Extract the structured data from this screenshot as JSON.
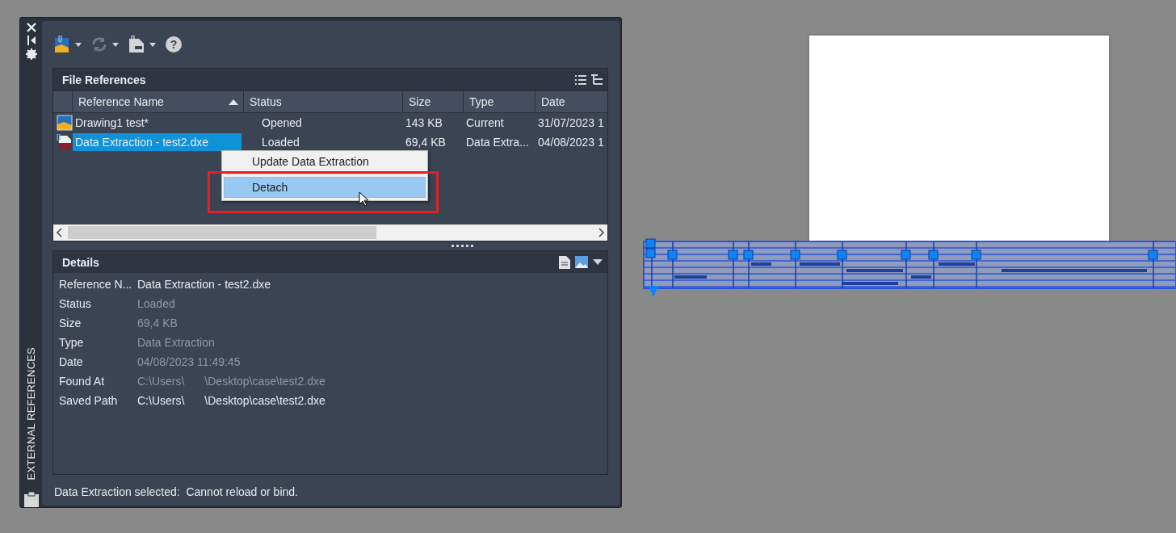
{
  "palette": {
    "title": "EXTERNAL REFERENCES",
    "help_glyph": "?"
  },
  "file_references": {
    "title": "File References",
    "columns": [
      {
        "label": "Reference Name",
        "sorted": true
      },
      {
        "label": "Status",
        "sorted": false
      },
      {
        "label": "Size",
        "sorted": false
      },
      {
        "label": "Type",
        "sorted": false
      },
      {
        "label": "Date",
        "sorted": false
      }
    ],
    "rows": [
      {
        "kind": "drawing",
        "name": "Drawing1 test*",
        "status": "Opened",
        "size": "143 KB",
        "type": "Current",
        "date": "31/07/2023 1",
        "selected": false
      },
      {
        "kind": "dxe",
        "name": "Data Extraction - test2.dxe",
        "status": "Loaded",
        "size": "69,4 KB",
        "type": "Data Extra...",
        "date": "04/08/2023 1",
        "selected": true
      }
    ]
  },
  "context_menu": {
    "items": [
      {
        "label": "Update Data Extraction",
        "selected": false
      },
      {
        "label": "Detach",
        "selected": true
      }
    ]
  },
  "details": {
    "title": "Details",
    "rows": [
      {
        "label": "Reference N...",
        "parts": [
          "Data Extraction - test2.dxe"
        ],
        "dimmed": false
      },
      {
        "label": "Status",
        "parts": [
          "Loaded"
        ],
        "dimmed": true
      },
      {
        "label": "Size",
        "parts": [
          "69,4 KB"
        ],
        "dimmed": true
      },
      {
        "label": "Type",
        "parts": [
          "Data Extraction"
        ],
        "dimmed": true
      },
      {
        "label": "Date",
        "parts": [
          "04/08/2023 11:49:45"
        ],
        "dimmed": true
      },
      {
        "label": "Found At",
        "parts": [
          "C:\\Users\\",
          "\\Desktop\\case\\test2.dxe"
        ],
        "dimmed": true
      },
      {
        "label": "Saved Path",
        "parts": [
          "C:\\Users\\",
          "\\Desktop\\case\\test2.dxe"
        ],
        "dimmed": false
      }
    ]
  },
  "status_text": "Data Extraction selected:  Cannot reload or bind."
}
